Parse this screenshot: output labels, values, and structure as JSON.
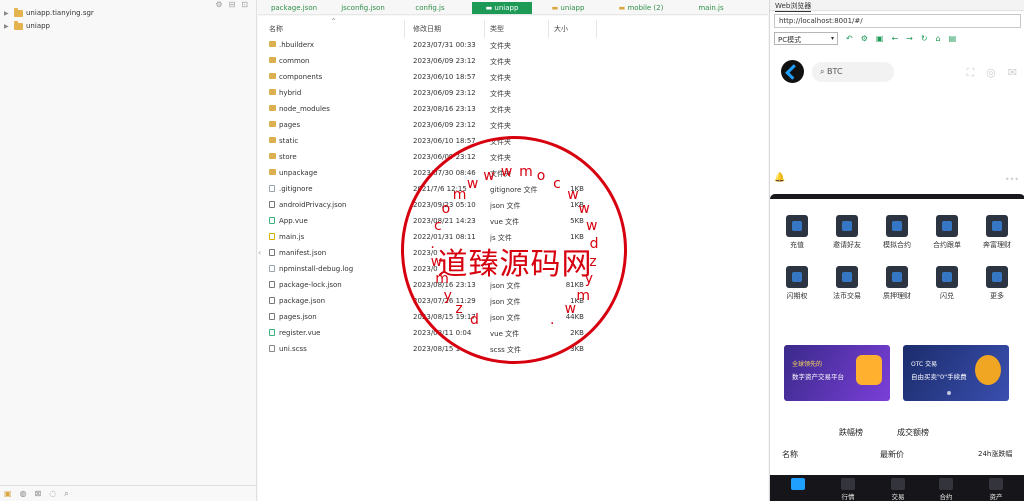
{
  "project_tree": {
    "items": [
      {
        "label": "uniapp.tianying.sgr"
      },
      {
        "label": "uniapp"
      }
    ]
  },
  "tabs": [
    {
      "label": "package.json"
    },
    {
      "label": "jsconfig.json"
    },
    {
      "label": "config.js"
    },
    {
      "label": "uniapp"
    },
    {
      "label": "uniapp"
    },
    {
      "label": "mobile (2)"
    },
    {
      "label": "main.js"
    }
  ],
  "explorer": {
    "columns": {
      "name": "名称",
      "date": "修改日期",
      "type": "类型",
      "size": "大小"
    },
    "rows": [
      {
        "name": ".hbuilderx",
        "date": "2023/07/31 00:33",
        "type": "文件夹",
        "size": "",
        "kind": "folder"
      },
      {
        "name": "common",
        "date": "2023/06/09 23:12",
        "type": "文件夹",
        "size": "",
        "kind": "folder"
      },
      {
        "name": "components",
        "date": "2023/06/10 18:57",
        "type": "文件夹",
        "size": "",
        "kind": "folder"
      },
      {
        "name": "hybrid",
        "date": "2023/06/09 23:12",
        "type": "文件夹",
        "size": "",
        "kind": "folder"
      },
      {
        "name": "node_modules",
        "date": "2023/08/16 23:13",
        "type": "文件夹",
        "size": "",
        "kind": "folder"
      },
      {
        "name": "pages",
        "date": "2023/06/09 23:12",
        "type": "文件夹",
        "size": "",
        "kind": "folder"
      },
      {
        "name": "static",
        "date": "2023/06/10 18:57",
        "type": "文件夹",
        "size": "",
        "kind": "folder"
      },
      {
        "name": "store",
        "date": "2023/06/09 23:12",
        "type": "文件夹",
        "size": "",
        "kind": "folder"
      },
      {
        "name": "unpackage",
        "date": "2023/07/30 08:46",
        "type": "文件夹",
        "size": "",
        "kind": "folder"
      },
      {
        "name": ".gitignore",
        "date": "2021/7/6 12:15",
        "type": "gitignore 文件",
        "size": "1KB",
        "kind": "file"
      },
      {
        "name": "androidPrivacy.json",
        "date": "2023/09/23 05:10",
        "type": "json 文件",
        "size": "1KB",
        "kind": "json"
      },
      {
        "name": "App.vue",
        "date": "2023/08/21 14:23",
        "type": "vue 文件",
        "size": "5KB",
        "kind": "vue"
      },
      {
        "name": "main.js",
        "date": "2022/01/31 08:11",
        "type": "js 文件",
        "size": "1KB",
        "kind": "js"
      },
      {
        "name": "manifest.json",
        "date": "2023/0",
        "type": "",
        "size": "",
        "kind": "json"
      },
      {
        "name": "npminstall-debug.log",
        "date": "2023/0",
        "type": "",
        "size": "",
        "kind": "file"
      },
      {
        "name": "package-lock.json",
        "date": "2023/08/16 23:13",
        "type": "json 文件",
        "size": "81KB",
        "kind": "json"
      },
      {
        "name": "package.json",
        "date": "2023/07/26 11:29",
        "type": "json 文件",
        "size": "1KB",
        "kind": "json"
      },
      {
        "name": "pages.json",
        "date": "2023/08/15 19:17",
        "type": "json 文件",
        "size": "44KB",
        "kind": "json"
      },
      {
        "name": "register.vue",
        "date": "2023/08/11 0:04",
        "type": "vue 文件",
        "size": "2KB",
        "kind": "vue"
      },
      {
        "name": "uni.scss",
        "date": "2023/08/15 1",
        "type": "scss 文件",
        "size": "3KB",
        "kind": "scss"
      }
    ]
  },
  "watermark": {
    "text": "道臻源码网",
    "letters": [
      "d",
      "z",
      "y",
      "m",
      "w",
      ".",
      "c",
      "o",
      "m",
      "w",
      "w",
      "w",
      "m",
      "o",
      "c",
      "w",
      "w",
      "w",
      "d",
      "z",
      "y",
      "m",
      "w",
      "."
    ]
  },
  "browser": {
    "title": "Web浏览器",
    "url": "http://localhost:8001/#/",
    "mode": "PC模式",
    "search_placeholder": "BTC",
    "grid": [
      {
        "label": "充值"
      },
      {
        "label": "邀请好友"
      },
      {
        "label": "模拟合约"
      },
      {
        "label": "合约跟单"
      },
      {
        "label": "奔富理财"
      },
      {
        "label": "闪期权"
      },
      {
        "label": "法币交易"
      },
      {
        "label": "质押理财"
      },
      {
        "label": "闪兑"
      },
      {
        "label": "更多"
      }
    ],
    "banner_left": {
      "line1": "全球领先的",
      "line2": "数字资产交易平台"
    },
    "banner_right": {
      "line1": "OTC 交易",
      "line2": "自由买卖\"0\"手续费"
    },
    "rank_tabs": [
      "涨幅榜",
      "跌幅榜",
      "成交额榜"
    ],
    "rank_head": {
      "name": "名称",
      "price": "最新价",
      "change": "24h涨跌幅"
    },
    "nav": [
      {
        "label": ""
      },
      {
        "label": "行情"
      },
      {
        "label": "交易"
      },
      {
        "label": "合约"
      },
      {
        "label": "资产"
      }
    ],
    "colors": {
      "accent": "#1fa0ff",
      "dark": "#16161a",
      "green": "#1e9a57"
    }
  }
}
